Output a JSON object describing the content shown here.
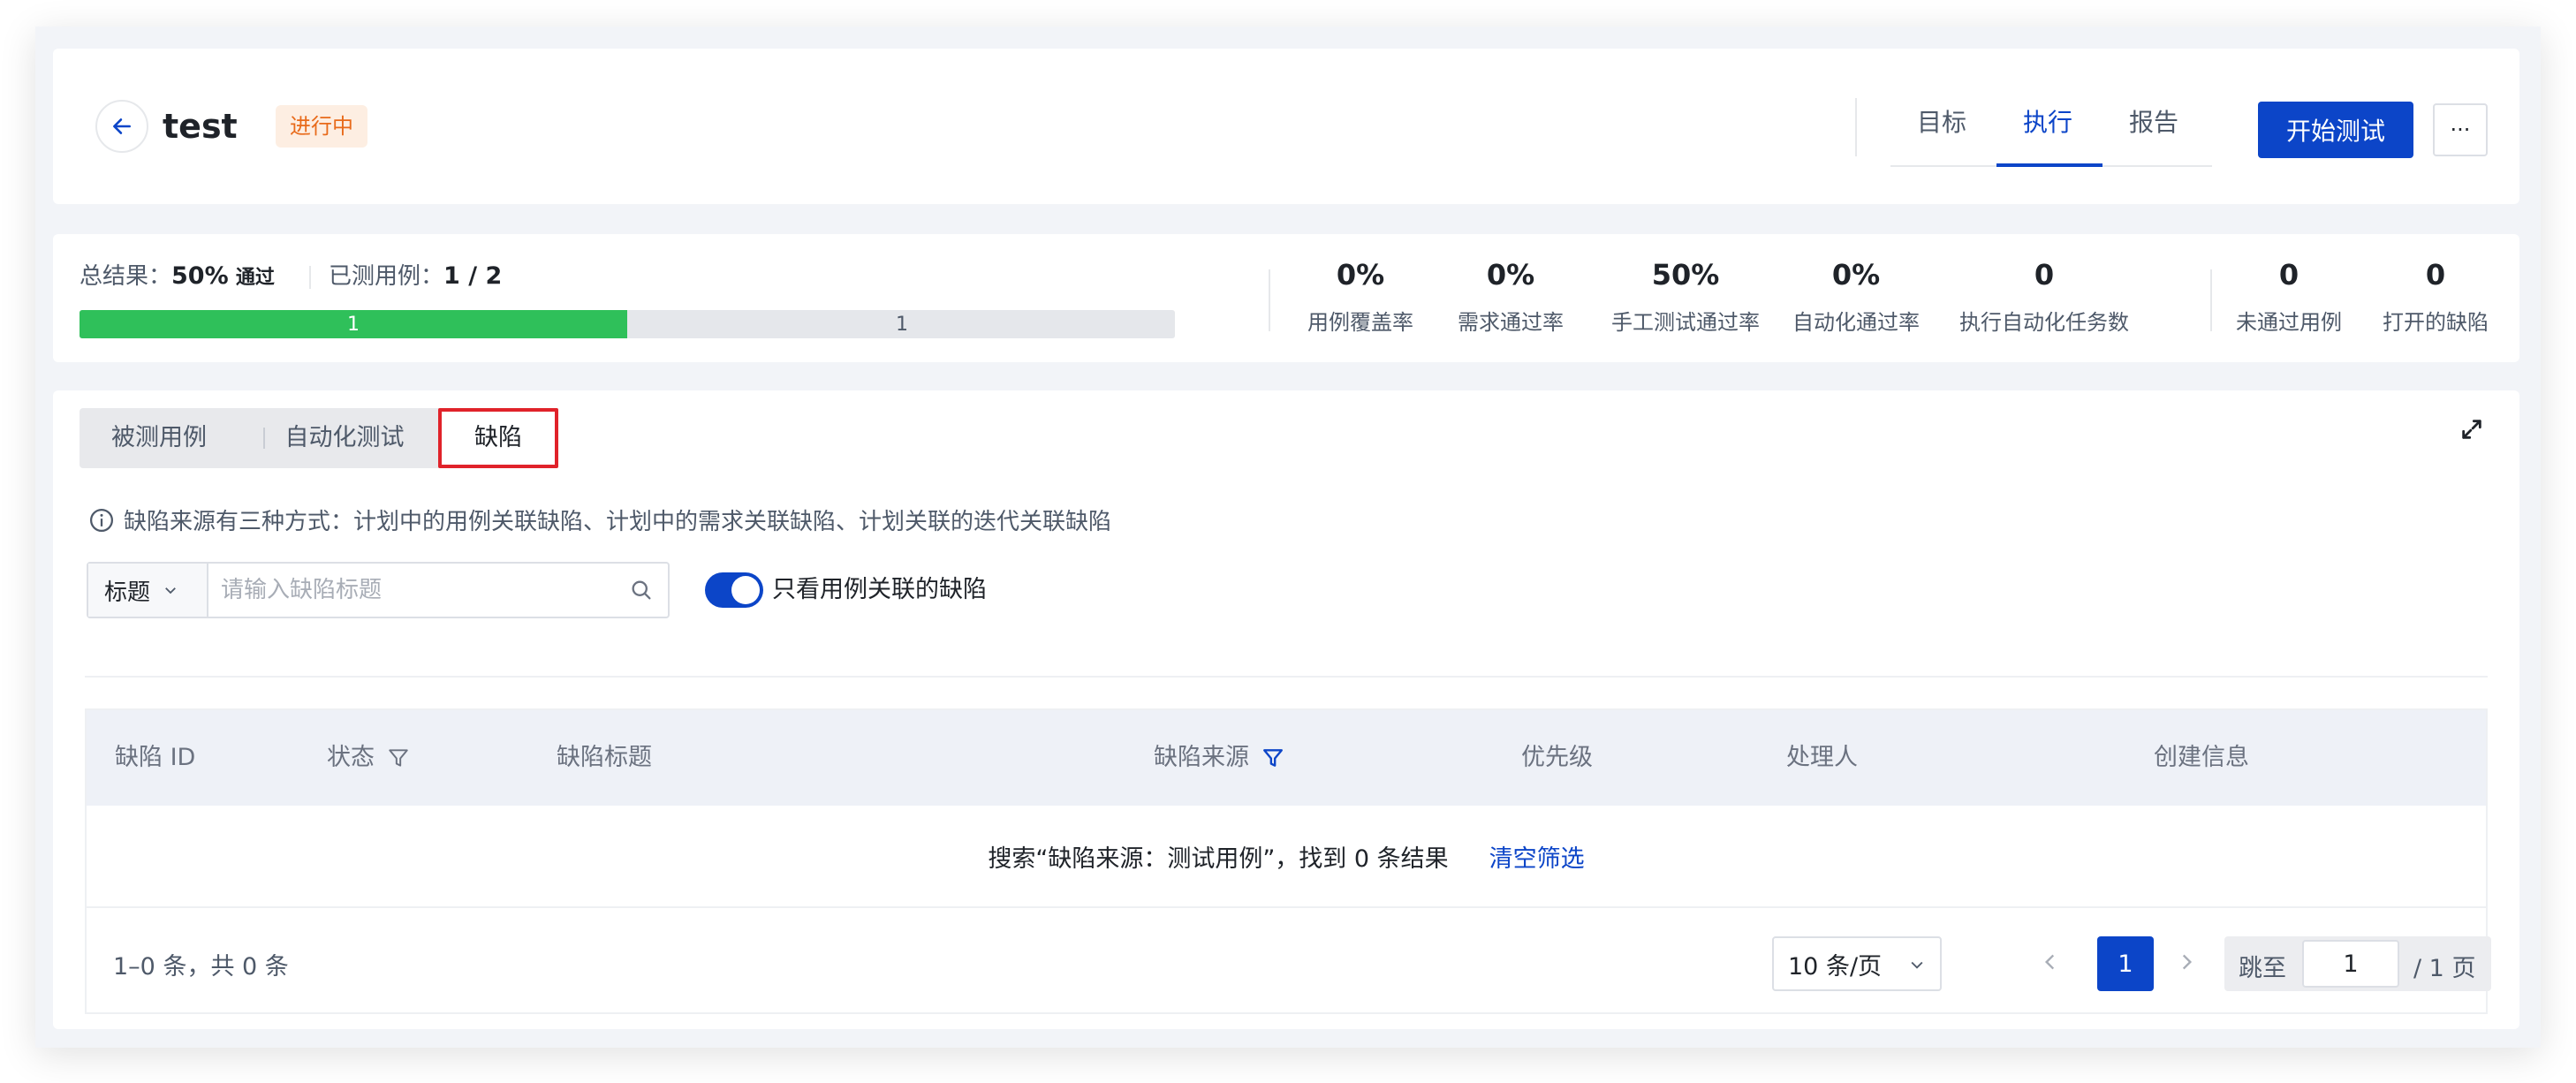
{
  "header": {
    "title": "test",
    "status": "进行中",
    "tabs": [
      {
        "label": "目标",
        "active": false
      },
      {
        "label": "执行",
        "active": true
      },
      {
        "label": "报告",
        "active": false
      }
    ],
    "start_button": "开始测试",
    "more_button": "···"
  },
  "summary": {
    "total_label": "总结果：",
    "total_value": "50%",
    "total_suffix": "通过",
    "tested_label": "已测用例：",
    "tested_value": "1 / 2",
    "progress": {
      "passed": 1,
      "remaining": 1,
      "passed_fraction": 0.5
    },
    "metrics": [
      {
        "value": "0%",
        "label": "用例覆盖率"
      },
      {
        "value": "0%",
        "label": "需求通过率"
      },
      {
        "value": "50%",
        "label": "手工测试通过率"
      },
      {
        "value": "0%",
        "label": "自动化通过率"
      },
      {
        "value": "0",
        "label": "执行自动化任务数"
      }
    ],
    "side_metrics": [
      {
        "value": "0",
        "label": "未通过用例"
      },
      {
        "value": "0",
        "label": "打开的缺陷"
      }
    ]
  },
  "main": {
    "segments": [
      {
        "label": "被测用例",
        "active": false
      },
      {
        "label": "自动化测试",
        "active": false
      },
      {
        "label": "缺陷",
        "active": true
      }
    ],
    "info_text": "缺陷来源有三种方式：计划中的用例关联缺陷、计划中的需求关联缺陷、计划关联的迭代关联缺陷",
    "filter_select": "标题",
    "search_placeholder": "请输入缺陷标题",
    "toggle_label": "只看用例关联的缺陷",
    "toggle_on": true,
    "table": {
      "columns": [
        "缺陷 ID",
        "状态",
        "缺陷标题",
        "缺陷来源",
        "优先级",
        "处理人",
        "创建信息"
      ],
      "empty_message": "搜索“缺陷来源：测试用例”，找到 0 条结果",
      "clear_filter": "清空筛选"
    },
    "footer": {
      "total_text": "1–0 条，共 0 条",
      "page_size": "10 条/页",
      "current_page": "1",
      "jump_label": "跳至",
      "jump_value": "1",
      "total_pages": "/ 1 页"
    }
  },
  "colors": {
    "primary": "#0c45c8",
    "pass": "#2fc05a",
    "status_badge_bg": "#fdeee2",
    "status_badge_text": "#e86a1a",
    "highlight": "#e0222a"
  }
}
